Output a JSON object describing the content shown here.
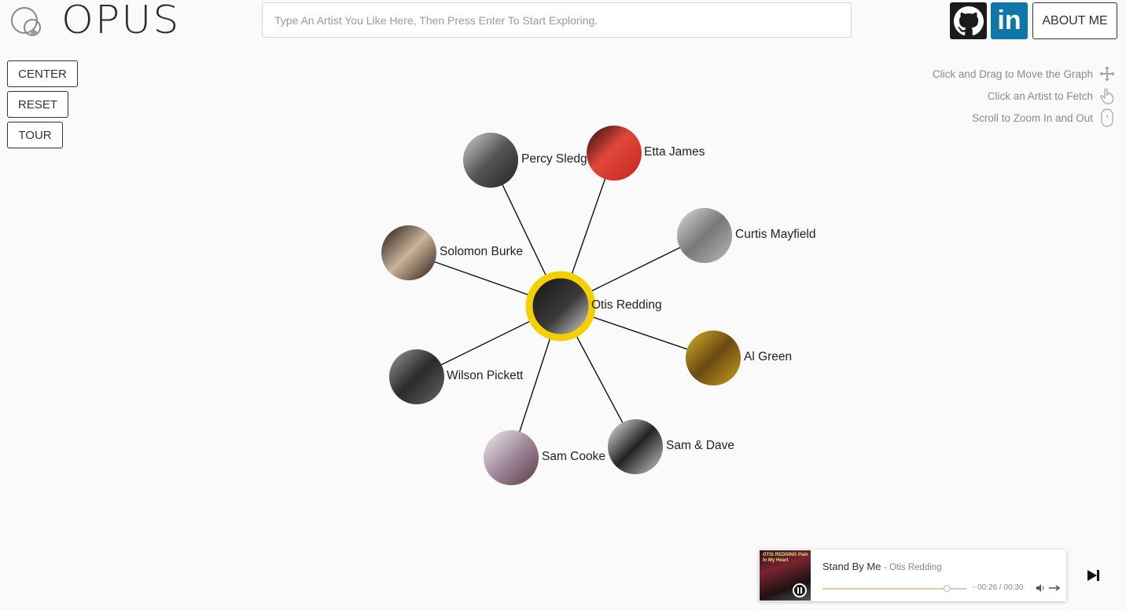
{
  "app": {
    "brand": "OPUS"
  },
  "header": {
    "search_placeholder": "Type An Artist You Like Here, Then Press Enter To Start Exploring.",
    "about_label": "ABOUT ME"
  },
  "controls": {
    "center": "CENTER",
    "reset": "RESET",
    "tour": "TOUR"
  },
  "hints": [
    {
      "text": "Click and Drag to Move the Graph",
      "icon": "move-icon"
    },
    {
      "text": "Click an Artist to Fetch",
      "icon": "hand-pointer-icon"
    },
    {
      "text": "Scroll to Zoom In and Out",
      "icon": "mouse-scroll-icon"
    }
  ],
  "graph": {
    "center": {
      "name": "Otis Redding",
      "highlight_color": "#f5d000"
    },
    "related": [
      {
        "name": "Percy Sledge"
      },
      {
        "name": "Etta James"
      },
      {
        "name": "Curtis Mayfield"
      },
      {
        "name": "Solomon Burke"
      },
      {
        "name": "Al Green"
      },
      {
        "name": "Wilson Pickett"
      },
      {
        "name": "Sam & Dave"
      },
      {
        "name": "Sam Cooke"
      }
    ]
  },
  "player": {
    "track": "Stand By Me",
    "artist_prefix": "- Otis Redding",
    "album_text": "OTIS REDDING Pain In My Heart",
    "time": "- 00:26 / 00:30",
    "progress_fraction": 0.8667
  },
  "colors": {
    "accent": "#f5d000",
    "linkedin": "#0e76a8",
    "github": "#1b1b1b"
  }
}
